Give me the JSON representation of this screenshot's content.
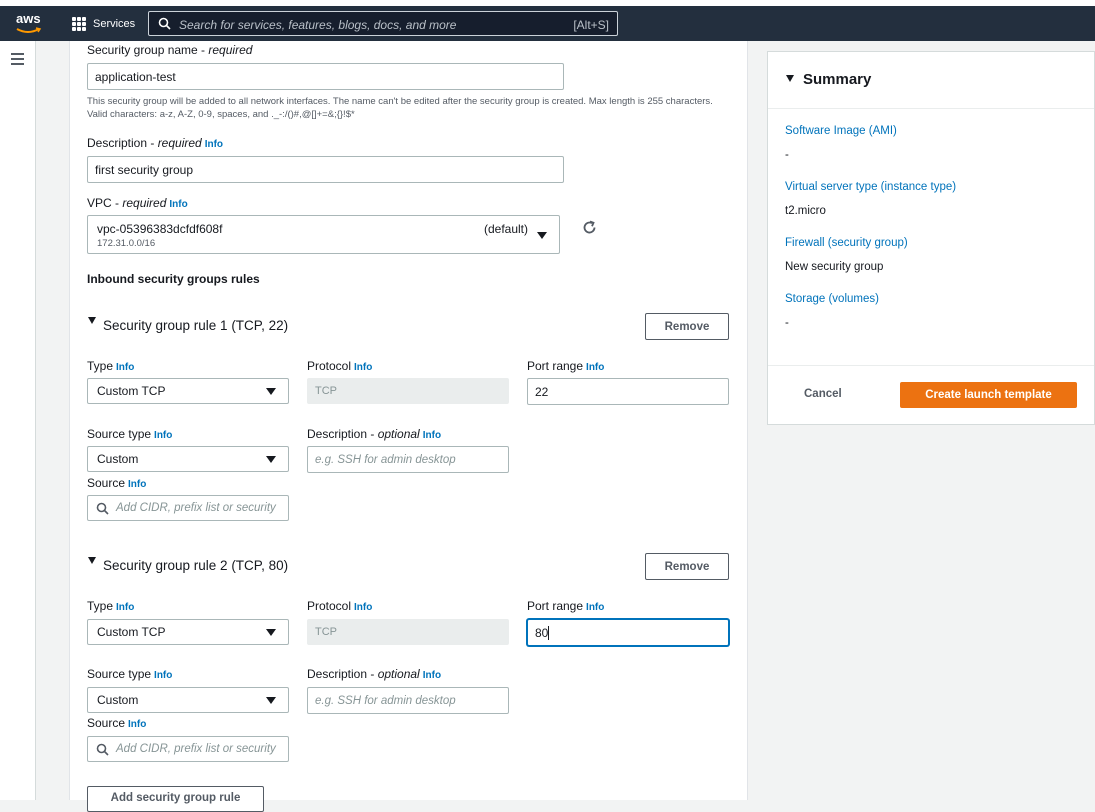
{
  "topbar": {
    "logo_text": "aws",
    "services_label": "Services",
    "search_placeholder": "Search for services, features, blogs, docs, and more",
    "search_shortcut": "[Alt+S]"
  },
  "form": {
    "sg_name_label": "Security group name - ",
    "sg_name_required": "required",
    "sg_name_value": "application-test",
    "sg_name_help": "This security group will be added to all network interfaces. The name can't be edited after the security group is created. Max length is 255 characters. Valid characters: a-z, A-Z, 0-9, spaces, and ._-:/()#,@[]+=&;{}!$*",
    "desc_label": "Description - ",
    "desc_required": "required",
    "info": "Info",
    "desc_value": "first security group",
    "vpc_label": "VPC - ",
    "vpc_required": "required",
    "vpc_value": "vpc-05396383dcfdf608f",
    "vpc_cidr": "172.31.0.0/16",
    "vpc_default": "(default)",
    "inbound_title": "Inbound security groups rules",
    "add_rule_label": "Add security group rule"
  },
  "rules": [
    {
      "title": "Security group rule 1 (TCP, 22)",
      "remove_label": "Remove",
      "type_label": "Type",
      "type_value": "Custom TCP",
      "protocol_label": "Protocol",
      "protocol_value": "TCP",
      "port_label": "Port range",
      "port_value": "22",
      "source_type_label": "Source type",
      "source_type_value": "Custom",
      "desc_label": "Description - ",
      "desc_optional": "optional",
      "desc_placeholder": "e.g. SSH for admin desktop",
      "source_label": "Source",
      "source_placeholder": "Add CIDR, prefix list or security"
    },
    {
      "title": "Security group rule 2 (TCP, 80)",
      "remove_label": "Remove",
      "type_label": "Type",
      "type_value": "Custom TCP",
      "protocol_label": "Protocol",
      "protocol_value": "TCP",
      "port_label": "Port range",
      "port_value": "80",
      "source_type_label": "Source type",
      "source_type_value": "Custom",
      "desc_label": "Description - ",
      "desc_optional": "optional",
      "desc_placeholder": "e.g. SSH for admin desktop",
      "source_label": "Source",
      "source_placeholder": "Add CIDR, prefix list or security"
    }
  ],
  "summary": {
    "title": "Summary",
    "ami_label": "Software Image (AMI)",
    "ami_value": "-",
    "instance_label": "Virtual server type (instance type)",
    "instance_value": "t2.micro",
    "firewall_label": "Firewall (security group)",
    "firewall_value": "New security group",
    "storage_label": "Storage (volumes)",
    "storage_value": "-",
    "cancel_label": "Cancel",
    "create_label": "Create launch template"
  },
  "colors": {
    "topbar": "#232f3e",
    "link": "#0073bb",
    "primary": "#ec7211"
  }
}
